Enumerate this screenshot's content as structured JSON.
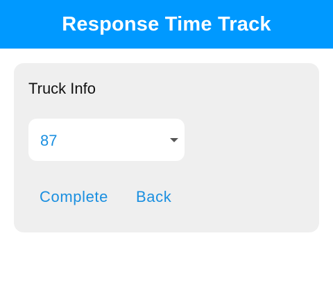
{
  "header": {
    "title": "Response Time Track"
  },
  "card": {
    "title": "Truck Info",
    "truck_select": {
      "selected": "87"
    },
    "actions": {
      "complete_label": "Complete",
      "back_label": "Back"
    }
  },
  "colors": {
    "header_bg": "#0099ff",
    "accent": "#1a8fe0",
    "card_bg": "#efefef"
  },
  "icons": {
    "select_caret": "caret-down-icon"
  }
}
